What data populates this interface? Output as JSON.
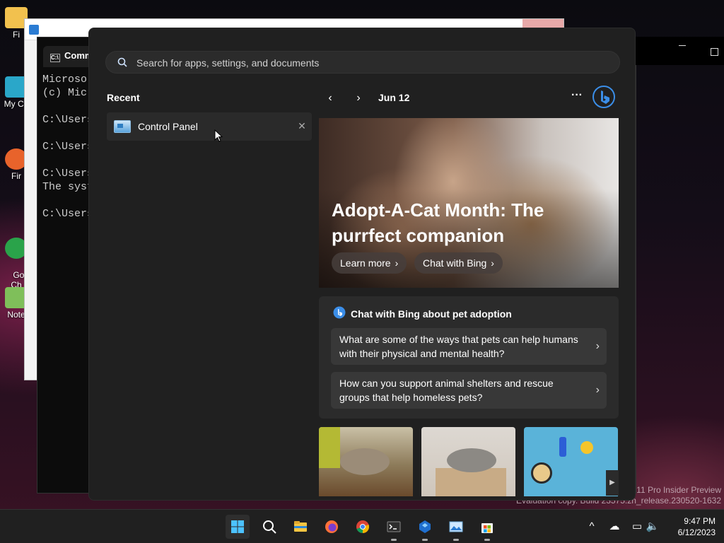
{
  "desktop": {
    "icons": [
      {
        "label": "Fi"
      },
      {
        "label": "My Co"
      },
      {
        "label": "Fir"
      },
      {
        "label": "Go\nCh"
      },
      {
        "label": "Note"
      }
    ]
  },
  "cmd_window": {
    "tab_label": "Comm",
    "console_text": "Microso\n(c) Mic\n\nC:\\Users\n\nC:\\Users\n\nC:\\Users\nThe syst\n\nC:\\Users"
  },
  "watermark": {
    "line1": "s 11 Pro Insider Preview",
    "line2": "Evaluation copy. Build 23575.zn_release.230520-1632"
  },
  "start_menu": {
    "search": {
      "placeholder": "Search for apps, settings, and documents",
      "icon": "search-icon"
    },
    "recent": {
      "title": "Recent",
      "items": [
        {
          "label": "Control Panel",
          "icon": "control-panel-icon"
        }
      ]
    },
    "feed": {
      "date": "Jun 12",
      "more_label": "···",
      "hero": {
        "headline": "Adopt-A-Cat Month: The purrfect companion",
        "learn_more": "Learn more",
        "chat_with_bing": "Chat with Bing"
      },
      "chat_card": {
        "title": "Chat with Bing about pet adoption",
        "questions": [
          "What are some of the ways that pets can help humans with their physical and mental health?",
          "How can you support animal shelters and rescue groups that help homeless pets?"
        ]
      }
    }
  },
  "taskbar": {
    "apps": [
      "start-icon",
      "search-icon",
      "file-explorer-icon",
      "firefox-icon",
      "chrome-icon",
      "terminal-icon",
      "app-icon",
      "photos-icon",
      "store-icon"
    ],
    "clock": {
      "time": "9:47 PM",
      "date": "6/12/2023"
    }
  },
  "colors": {
    "accent": "#0078d4",
    "menu_bg": "#202020",
    "card_bg": "#2b2b2b"
  }
}
